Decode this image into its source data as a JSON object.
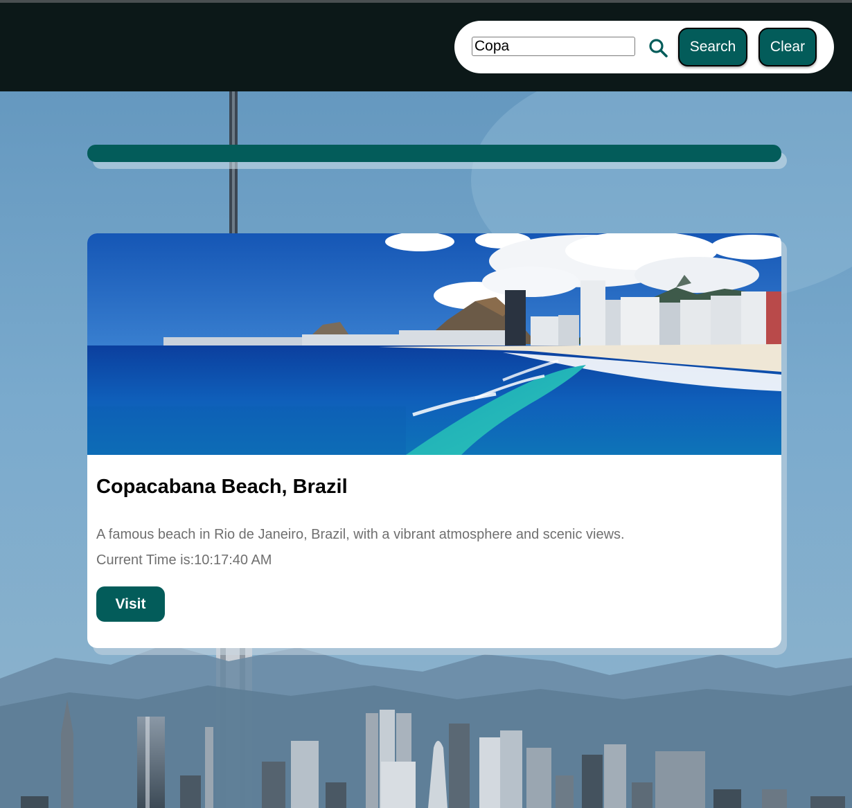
{
  "header": {
    "search": {
      "value": "Copa",
      "icon": "search-icon"
    },
    "search_button_label": "Search",
    "clear_button_label": "Clear"
  },
  "card": {
    "title": "Copacabana Beach, Brazil",
    "description": "A famous beach in Rio de Janeiro, Brazil, with a vibrant atmosphere and scenic views.",
    "time_text": "Current Time is:10:17:40 AM",
    "visit_label": "Visit"
  },
  "colors": {
    "navbar": "#0c1818",
    "accent": "#035c5a",
    "card": "#ffffff",
    "text_muted": "#6f6f6f"
  }
}
